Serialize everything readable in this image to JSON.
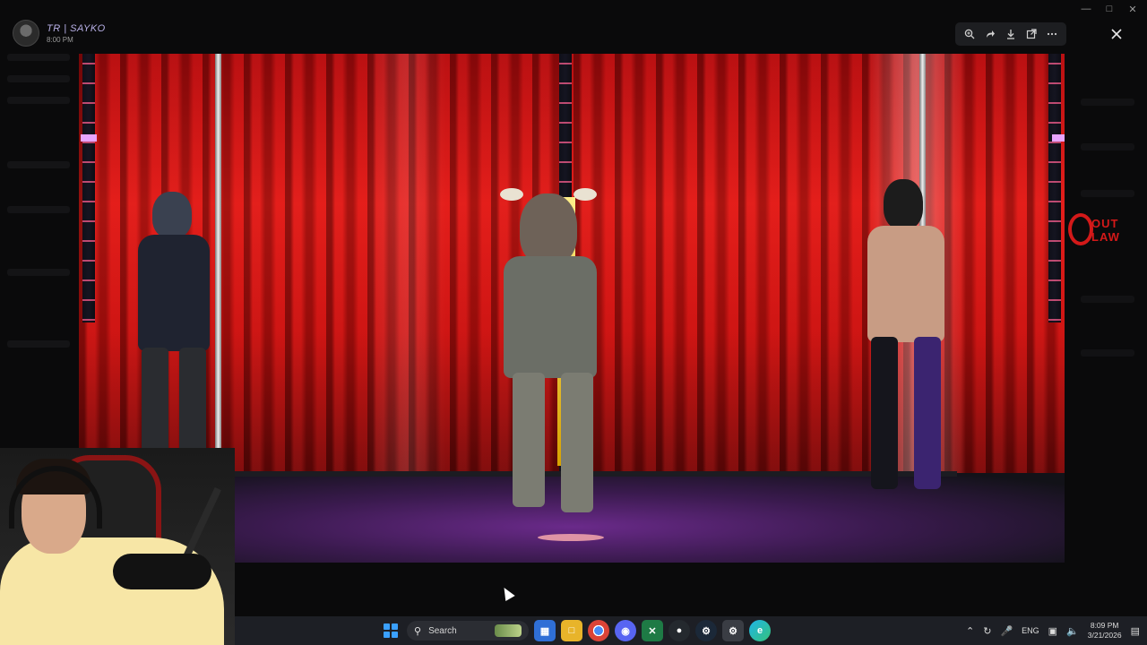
{
  "post": {
    "username": "TR | SAYKO",
    "time": "8:00 PM"
  },
  "toolbar": {
    "zoom_icon": "zoom-in-icon",
    "forward_icon": "forward-icon",
    "download_icon": "download-icon",
    "open_icon": "open-external-icon",
    "more_icon": "more-icon",
    "close_icon": "close-icon"
  },
  "image": {
    "logo_line1": "OUT",
    "logo_line2": "LAW"
  },
  "taskbar": {
    "search_label": "Search",
    "language": "ENG",
    "time": "8:09 PM",
    "date": "3/21/2026",
    "apps": [
      "store",
      "explorer",
      "chrome",
      "discord",
      "terminal",
      "github",
      "steam",
      "settings",
      "edge"
    ]
  },
  "colors": {
    "curtain": "#d0120f",
    "floor": "#6a2a8a",
    "accent_logo": "#d31919",
    "taskbar": "#1d1f25"
  }
}
